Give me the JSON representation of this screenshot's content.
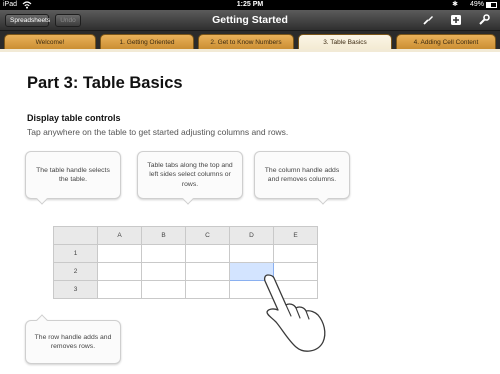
{
  "status": {
    "carrier": "iPad",
    "time": "1:25 PM",
    "battery": "49%"
  },
  "toolbar": {
    "spreadsheets_label": "Spreadsheets",
    "undo_label": "Undo",
    "title": "Getting Started"
  },
  "tabs": [
    {
      "label": "Welcome!"
    },
    {
      "label": "1. Getting Oriented"
    },
    {
      "label": "2. Get to Know Numbers"
    },
    {
      "label": "3. Table Basics"
    },
    {
      "label": "4. Adding Cell Content"
    }
  ],
  "content": {
    "heading": "Part 3: Table Basics",
    "subhead": "Display table controls",
    "subtext": "Tap anywhere on the table to get started adjusting columns and rows."
  },
  "callouts": {
    "table_handle": "The table handle selects the table.",
    "table_tabs": "Table tabs along the top and left sides select columns or rows.",
    "column_handle": "The column handle adds and removes columns.",
    "row_handle": "The row handle adds and removes rows."
  },
  "table": {
    "columns": [
      "A",
      "B",
      "C",
      "D",
      "E"
    ],
    "rows": [
      "1",
      "2",
      "3"
    ]
  },
  "colors": {
    "accent_tab": "#d99a3e",
    "selection": "#d3e4ff"
  }
}
